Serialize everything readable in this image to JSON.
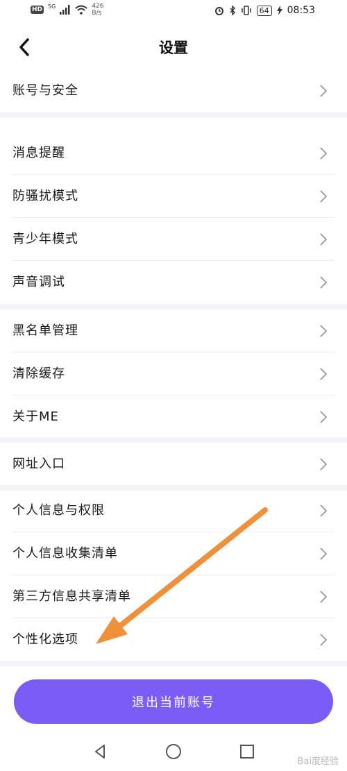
{
  "status_bar": {
    "hd": "HD",
    "network": "5G",
    "speed_value": "426",
    "speed_unit": "B/s",
    "battery": "64",
    "time": "08:53"
  },
  "header": {
    "title": "设置"
  },
  "settings_items": [
    {
      "label": "账号与安全"
    },
    {
      "label": "消息提醒"
    },
    {
      "label": "防骚扰模式"
    },
    {
      "label": "青少年模式"
    },
    {
      "label": "声音调试"
    },
    {
      "label": "黑名单管理"
    },
    {
      "label": "清除缓存"
    },
    {
      "label": "关于ME"
    },
    {
      "label": "网址入口"
    },
    {
      "label": "个人信息与权限"
    },
    {
      "label": "个人信息收集清单"
    },
    {
      "label": "第三方信息共享清单"
    },
    {
      "label": "个性化选项"
    }
  ],
  "logout_button": {
    "label": "退出当前账号"
  },
  "watermark": {
    "text": "Bai度经验"
  },
  "colors": {
    "accent": "#7b5cf5",
    "section_gap": "#f2f3f7",
    "arrow": "#f0903a"
  }
}
